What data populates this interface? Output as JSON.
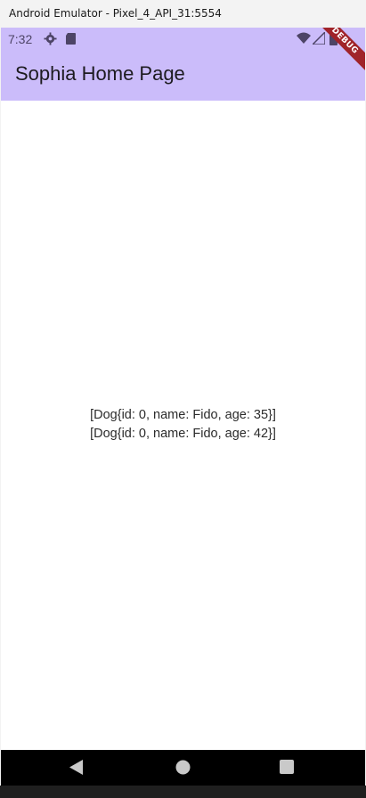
{
  "window": {
    "title": "Android Emulator - Pixel_4_API_31:5554"
  },
  "status_bar": {
    "time": "7:32",
    "left_icons": [
      "gear-icon",
      "sd-card-icon"
    ],
    "right_icons": [
      "wifi-icon",
      "signal-icon",
      "battery-icon"
    ]
  },
  "app_bar": {
    "title": "Sophia Home Page",
    "color": "#cbbcfa"
  },
  "debug_banner": {
    "label": "DEBUG"
  },
  "content": {
    "lines": [
      "[Dog{id: 0, name: Fido, age: 35}]",
      "[Dog{id: 0, name: Fido, age: 42}]"
    ]
  },
  "nav_bar": {
    "buttons": [
      "back-icon",
      "home-icon",
      "recents-icon"
    ]
  }
}
